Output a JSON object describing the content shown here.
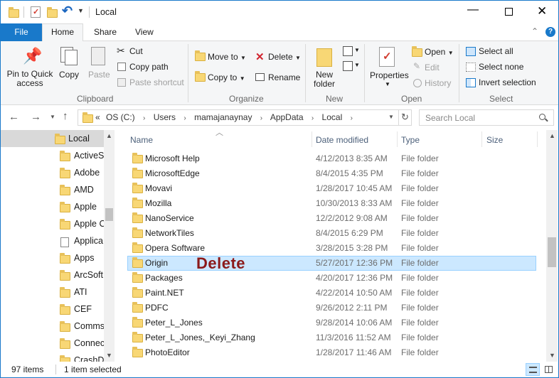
{
  "window": {
    "title": "Local"
  },
  "ribbon_tabs": [
    "File",
    "Home",
    "Share",
    "View"
  ],
  "clipboard": {
    "pin_label": [
      "Pin to Quick",
      "access"
    ],
    "copy": "Copy",
    "paste": "Paste",
    "cut": "Cut",
    "copy_path": "Copy path",
    "paste_shortcut": "Paste shortcut",
    "group": "Clipboard"
  },
  "organize": {
    "move_to": "Move to",
    "copy_to": "Copy to",
    "delete": "Delete",
    "rename": "Rename",
    "group": "Organize"
  },
  "new": {
    "new_folder": [
      "New",
      "folder"
    ],
    "group": "New"
  },
  "open": {
    "properties": "Properties",
    "open": "Open",
    "edit": "Edit",
    "history": "History",
    "group": "Open"
  },
  "select": {
    "select_all": "Select all",
    "select_none": "Select none",
    "invert": "Invert selection",
    "group": "Select"
  },
  "address": {
    "chevron": "«",
    "crumbs": [
      "OS (C:)",
      "Users",
      "mamajanaynay",
      "AppData",
      "Local"
    ],
    "search_placeholder": "Search Local"
  },
  "nav_pane": {
    "items": [
      "Local",
      "ActiveSy",
      "Adobe",
      "AMD",
      "Apple",
      "Apple C",
      "Applica",
      "Apps",
      "ArcSoft",
      "ATI",
      "CEF",
      "Comms",
      "Connec",
      "CrashDu"
    ]
  },
  "columns": {
    "name": "Name",
    "date": "Date modified",
    "type": "Type",
    "size": "Size"
  },
  "files": [
    {
      "name": "Microsoft Help",
      "date": "4/12/2013 8:35 AM",
      "type": "File folder"
    },
    {
      "name": "MicrosoftEdge",
      "date": "8/4/2015 4:35 PM",
      "type": "File folder"
    },
    {
      "name": "Movavi",
      "date": "1/28/2017 10:45 AM",
      "type": "File folder"
    },
    {
      "name": "Mozilla",
      "date": "10/30/2013 8:33 AM",
      "type": "File folder"
    },
    {
      "name": "NanoService",
      "date": "12/2/2012 9:08 AM",
      "type": "File folder"
    },
    {
      "name": "NetworkTiles",
      "date": "8/4/2015 6:29 PM",
      "type": "File folder"
    },
    {
      "name": "Opera Software",
      "date": "3/28/2015 3:28 PM",
      "type": "File folder"
    },
    {
      "name": "Origin",
      "date": "5/27/2017 12:36 PM",
      "type": "File folder"
    },
    {
      "name": "Packages",
      "date": "4/20/2017 12:36 PM",
      "type": "File folder"
    },
    {
      "name": "Paint.NET",
      "date": "4/22/2014 10:50 AM",
      "type": "File folder"
    },
    {
      "name": "PDFC",
      "date": "9/26/2012 2:11 PM",
      "type": "File folder"
    },
    {
      "name": "Peter_L_Jones",
      "date": "9/28/2014 10:06 AM",
      "type": "File folder"
    },
    {
      "name": "Peter_L_Jones,_Keyi_Zhang",
      "date": "11/3/2016 11:52 AM",
      "type": "File folder"
    },
    {
      "name": "PhotoEditor",
      "date": "1/28/2017 11:46 AM",
      "type": "File folder"
    }
  ],
  "annotation": "Delete",
  "status": {
    "items": "97 items",
    "selected": "1 item selected"
  },
  "colors": {
    "accent": "#1979ca",
    "selection": "#cce8ff",
    "annotation": "#8b1a1a"
  }
}
